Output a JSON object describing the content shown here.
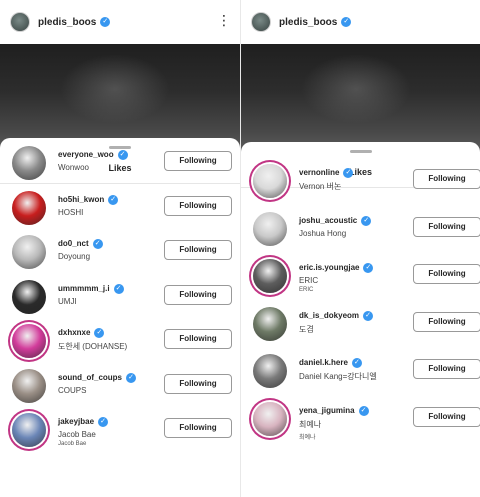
{
  "left": {
    "account": "pledis_boos",
    "more_icon": "more-vertical-icon",
    "sheet_title": "Likes",
    "rows": [
      {
        "handle": "everyone_woo",
        "name": "Wonwoo",
        "button": "Following",
        "color": "#8a8a8a"
      },
      {
        "handle": "ho5hi_kwon",
        "name": "HOSHI",
        "button": "Following",
        "color": "#c81e1e"
      },
      {
        "handle": "do0_nct",
        "name": "Doyoung",
        "button": "Following",
        "color": "#b9b9b9"
      },
      {
        "handle": "ummmmm_j.i",
        "name": "UMJI",
        "button": "Following",
        "color": "#2a2a2a"
      },
      {
        "handle": "dxhxnxe",
        "name": "도한세 (DOHANSE)",
        "button": "Following",
        "color": "#d23c9b"
      },
      {
        "handle": "sound_of_coups",
        "name": "COUPS",
        "button": "Following",
        "color": "#9a8f86"
      },
      {
        "handle": "jakeyjbae",
        "name": "Jacob Bae",
        "extra": "Jacob Bae",
        "button": "Following",
        "color": "#6b86b7"
      }
    ]
  },
  "right": {
    "account": "pledis_boos",
    "sheet_title": "Likes",
    "rows": [
      {
        "handle": "vernonline",
        "name": "Vernon 버논",
        "button": "Following",
        "color": "#d9d9d9"
      },
      {
        "handle": "joshu_acoustic",
        "name": "Joshua Hong",
        "button": "Following",
        "color": "#c9c9c9"
      },
      {
        "handle": "eric.is.youngjae",
        "name": "ERIC",
        "extra": "ERIC",
        "button": "Following",
        "color": "#5d5d5d"
      },
      {
        "handle": "dk_is_dokyeom",
        "name": "도겸",
        "button": "Following",
        "color": "#6e7a66"
      },
      {
        "handle": "daniel.k.here",
        "name": "Daniel Kang=강다니엘",
        "button": "Following",
        "color": "#7a7a7a"
      },
      {
        "handle": "yena_jigumina",
        "name": "최예나",
        "extra": "최예나",
        "button": "Following",
        "color": "#d8b4c0"
      }
    ]
  }
}
